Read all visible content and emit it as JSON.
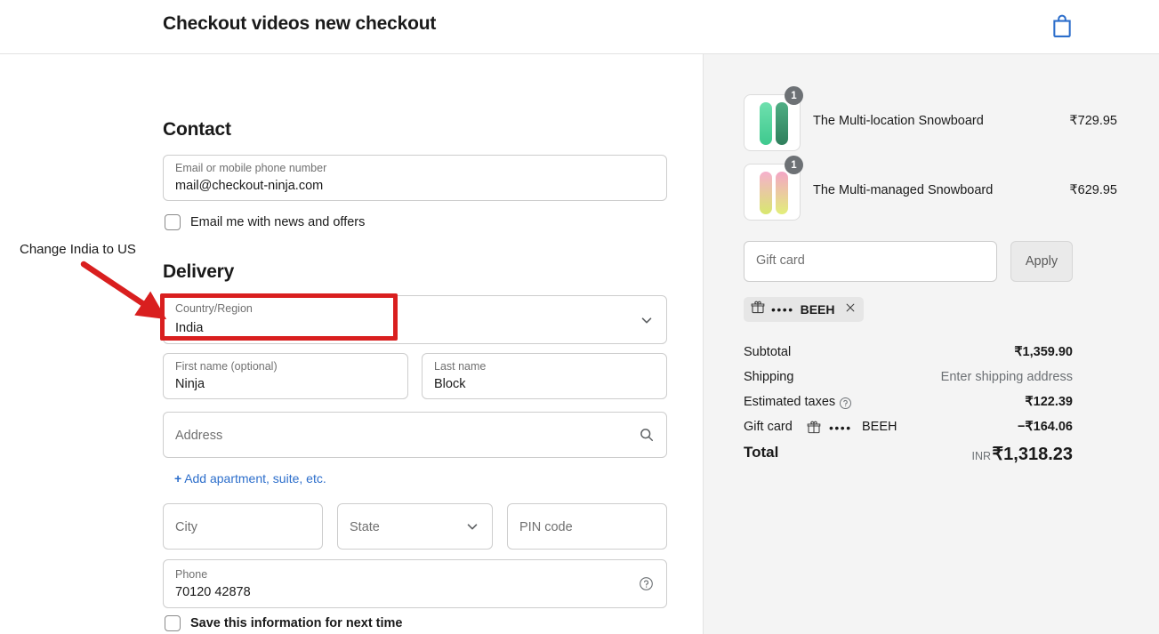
{
  "header": {
    "title": "Checkout videos new checkout",
    "cart_icon": "shopping-bag-icon"
  },
  "annotation": {
    "text": "Change India to US",
    "arrow_color": "#d91f1f",
    "highlight_color": "#d91f1f",
    "target": "country-region-field"
  },
  "contact": {
    "heading": "Contact",
    "email_field": {
      "label": "Email or mobile phone number",
      "value": "mail@checkout-ninja.com"
    },
    "newsletter_checkbox": {
      "label": "Email me with news and offers",
      "checked": false
    }
  },
  "delivery": {
    "heading": "Delivery",
    "country": {
      "label": "Country/Region",
      "value": "India",
      "icon": "chevron-down-icon"
    },
    "first_name": {
      "label": "First name (optional)",
      "value": "Ninja"
    },
    "last_name": {
      "label": "Last name",
      "value": "Block"
    },
    "address": {
      "placeholder": "Address",
      "icon": "search-icon"
    },
    "add_apartment_link": "Add apartment, suite, etc.",
    "city": {
      "placeholder": "City"
    },
    "state": {
      "placeholder": "State",
      "icon": "chevron-down-icon"
    },
    "pin_code": {
      "placeholder": "PIN code"
    },
    "phone": {
      "label": "Phone",
      "value": "70120 42878",
      "icon": "help-circle-icon"
    },
    "save_info_checkbox": {
      "label": "Save this information for next time",
      "checked": false
    }
  },
  "order_summary": {
    "items": [
      {
        "title": "The Multi-location Snowboard",
        "price": "₹729.95",
        "quantity": "1",
        "thumb_colors": [
          "#5fd8a4",
          "#3f9c6d"
        ]
      },
      {
        "title": "The Multi-managed Snowboard",
        "price": "₹629.95",
        "quantity": "1",
        "thumb_colors": [
          "#f2a7c3",
          "#d4e86a"
        ]
      }
    ],
    "gift_card_input": {
      "placeholder": "Gift card"
    },
    "apply_button": "Apply",
    "gift_card_chip": {
      "icon": "gift-icon",
      "dots": "••••",
      "code": "BEEH",
      "remove_icon": "close-icon"
    },
    "rows": [
      {
        "label": "Subtotal",
        "value": "₹1,359.90",
        "muted": false
      },
      {
        "label": "Shipping",
        "value": "Enter shipping address",
        "muted": true
      },
      {
        "label": "Estimated taxes",
        "value": "₹122.39",
        "muted": false,
        "icon": "help-circle-icon"
      },
      {
        "label": "Gift card",
        "value": "−₹164.06",
        "muted": false,
        "icon": "gift-icon",
        "dots": "••••",
        "code": "BEEH"
      }
    ],
    "total": {
      "label": "Total",
      "currency": "INR",
      "value": "₹1,318.23"
    }
  }
}
